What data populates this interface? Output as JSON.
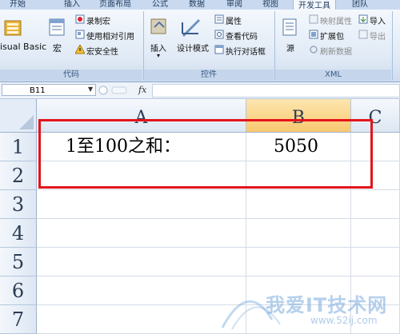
{
  "ribbon_tabs": [
    "开始",
    "插入",
    "页面布局",
    "公式",
    "数据",
    "审阅",
    "视图",
    "开发工具",
    "团队"
  ],
  "active_tab_index": 7,
  "groups": {
    "code": {
      "label": "代码",
      "vb_label": "isual Basic",
      "macro_label": "宏",
      "record_macro": "录制宏",
      "relative_ref": "使用相对引用",
      "macro_security": "宏安全性"
    },
    "controls": {
      "label": "控件",
      "insert_label": "插入",
      "design_mode": "设计模式",
      "properties": "属性",
      "view_code": "查看代码",
      "run_dialog": "执行对话框"
    },
    "xml": {
      "label": "XML",
      "source_label": "源",
      "map_props": "映射属性",
      "expansion_packs": "扩展包",
      "refresh_data": "刷新数据",
      "import": "导入",
      "export": "导出"
    }
  },
  "name_box": "B11",
  "fx_label": "fx",
  "formula_value": "",
  "columns": [
    "A",
    "B",
    "C"
  ],
  "selected_column": "B",
  "rows": [
    "1",
    "2",
    "3",
    "4",
    "5",
    "6",
    "7"
  ],
  "cells": {
    "A1": "1至100之和：",
    "B1": "5050"
  },
  "watermark": {
    "text": "我爱IT技术网",
    "url": "www.52ij.com"
  },
  "colors": {
    "highlight_box": "#e3141c",
    "selected_header": "#f8c86e"
  }
}
